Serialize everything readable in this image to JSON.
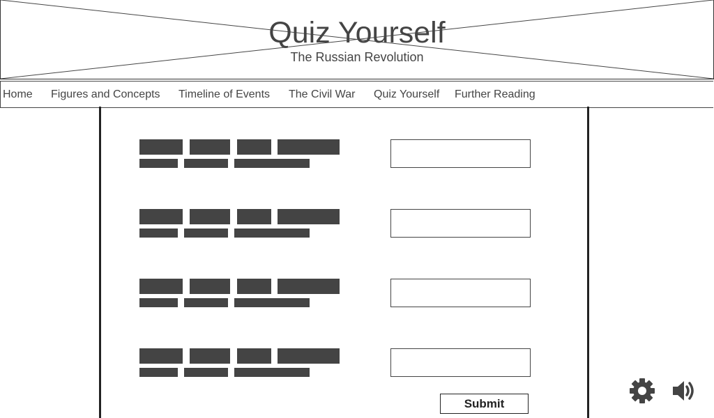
{
  "header": {
    "title": "Quiz Yourself",
    "subtitle": "The Russian Revolution"
  },
  "nav": {
    "items": [
      {
        "label": "Home"
      },
      {
        "label": "Figures and Concepts"
      },
      {
        "label": "Timeline of Events"
      },
      {
        "label": "The Civil War"
      },
      {
        "label": "Quiz Yourself"
      },
      {
        "label": "Further Reading"
      }
    ]
  },
  "quiz": {
    "question_count": 4,
    "submit_label": "Submit"
  },
  "controls": {
    "settings_icon": "gear-icon",
    "sound_icon": "speaker-icon"
  },
  "colors": {
    "placeholder_bar": "#444444",
    "border": "#333333"
  }
}
